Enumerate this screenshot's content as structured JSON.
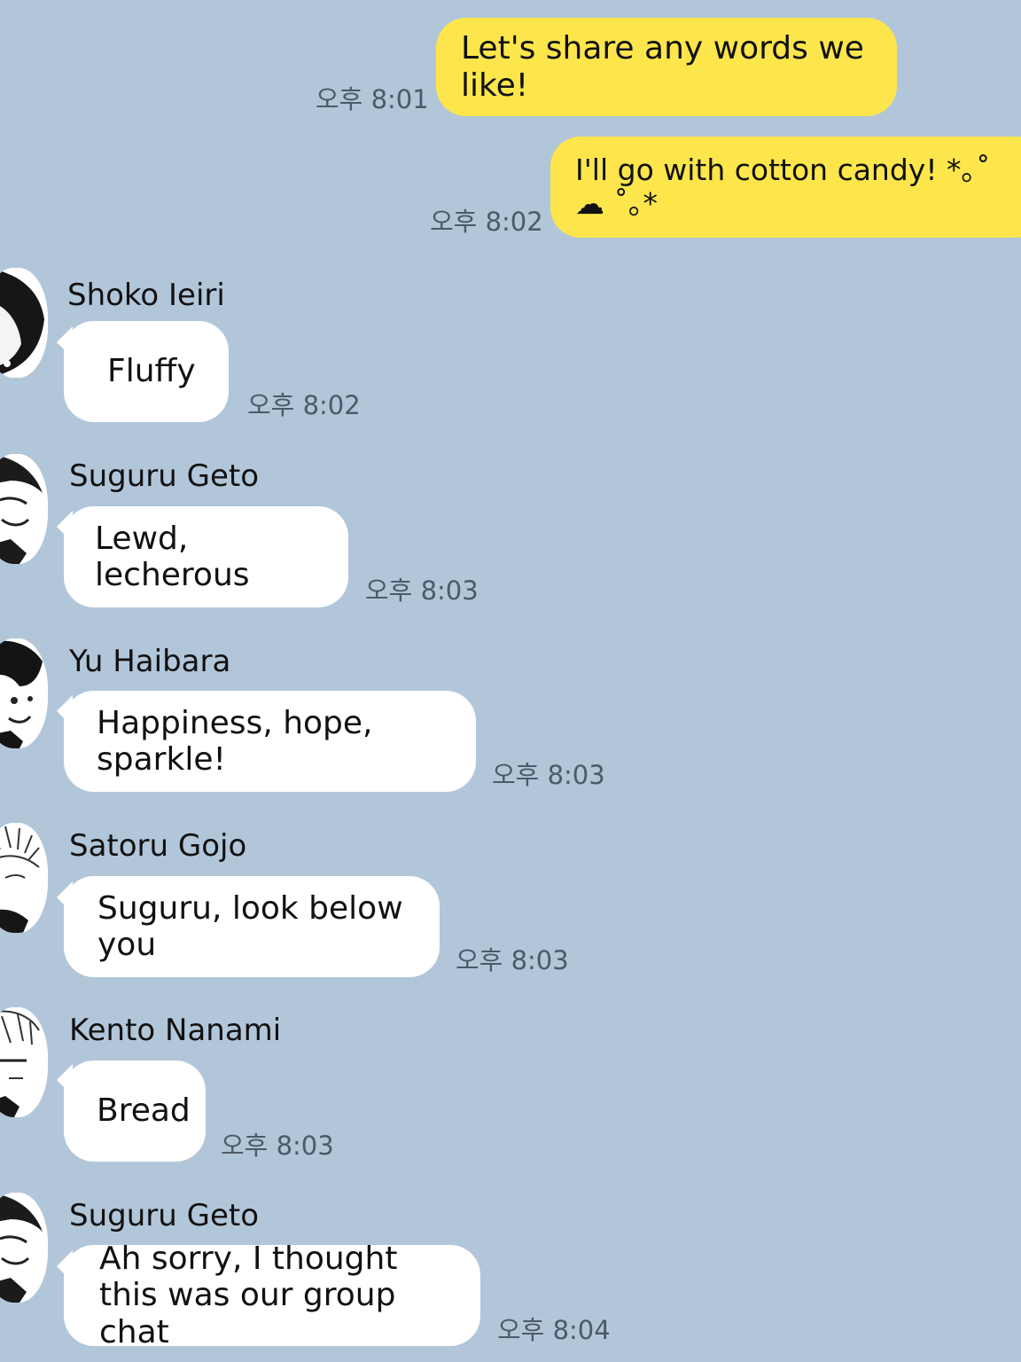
{
  "colors": {
    "background": "#b2c6da",
    "my_bubble": "#fde64b",
    "their_bubble": "#ffffff",
    "timestamp": "#4d5a66"
  },
  "messages": [
    {
      "from": "me",
      "text": "Let's share any words we like!",
      "time": "오후 8:01"
    },
    {
      "from": "me",
      "text": "I'll go with cotton candy! *｡˚ ☁ ˚｡*",
      "time": "오후 8:02"
    },
    {
      "from": "other",
      "sender": "Shoko Ieiri",
      "avatar": "avatar-icon",
      "text": "Fluffy",
      "time": "오후 8:02"
    },
    {
      "from": "other",
      "sender": "Suguru Geto",
      "avatar": "avatar-icon",
      "text": "Lewd, lecherous",
      "time": "오후 8:03"
    },
    {
      "from": "other",
      "sender": "Yu Haibara",
      "avatar": "avatar-icon",
      "text": "Happiness, hope, sparkle!",
      "time": "오후 8:03"
    },
    {
      "from": "other",
      "sender": "Satoru Gojo",
      "avatar": "avatar-icon",
      "text": "Suguru, look below you",
      "time": "오후 8:03"
    },
    {
      "from": "other",
      "sender": "Kento Nanami",
      "avatar": "avatar-icon",
      "text": "Bread",
      "time": "오후 8:03"
    },
    {
      "from": "other",
      "sender": "Suguru Geto",
      "avatar": "avatar-icon",
      "text": "Ah sorry, I thought this was our group chat",
      "time": "오후 8:04"
    }
  ]
}
